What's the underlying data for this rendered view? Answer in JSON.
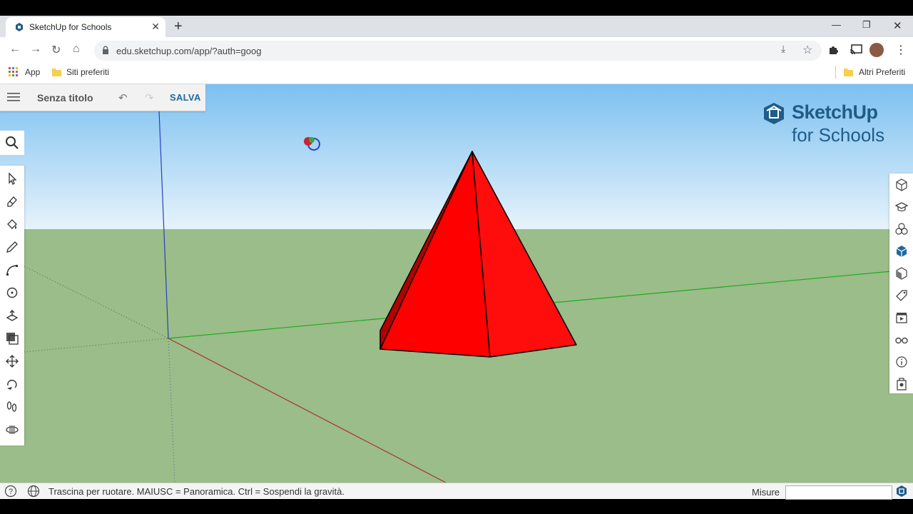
{
  "browser": {
    "tab_title": "SketchUp for Schools",
    "url": "edu.sketchup.com/app/?auth=goog",
    "bookmarks": {
      "apps": "App",
      "folder": "Siti preferiti",
      "other": "Altri Preferiti"
    }
  },
  "app": {
    "document_title": "Senza titolo",
    "save_label": "SALVA",
    "logo_line1": "SketchUp",
    "logo_line2": "for Schools"
  },
  "status": {
    "hint": "Trascina per ruotare. MAIUSC = Panoramica. Ctrl = Sospendi la gravità.",
    "measurements_label": "Misure",
    "measurements_value": ""
  },
  "colors": {
    "sky_top": "#7cc0f0",
    "ground": "#9abd89",
    "pyramid": "#ff0000",
    "accent": "#1f6a9e"
  },
  "icons": {
    "left_toolbar": [
      "select-icon",
      "eraser-icon",
      "paint-bucket-icon",
      "pencil-icon",
      "arc-icon",
      "shapes-icon",
      "push-pull-icon",
      "offset-icon",
      "move-icon",
      "rotate-icon",
      "footprints-icon",
      "orbit-icon"
    ],
    "right_toolbar": [
      "entity-info-icon",
      "instructor-icon",
      "components-icon",
      "materials-icon",
      "styles-icon",
      "tags-icon",
      "scenes-icon",
      "display-icon",
      "info-icon",
      "solid-tools-icon"
    ]
  }
}
